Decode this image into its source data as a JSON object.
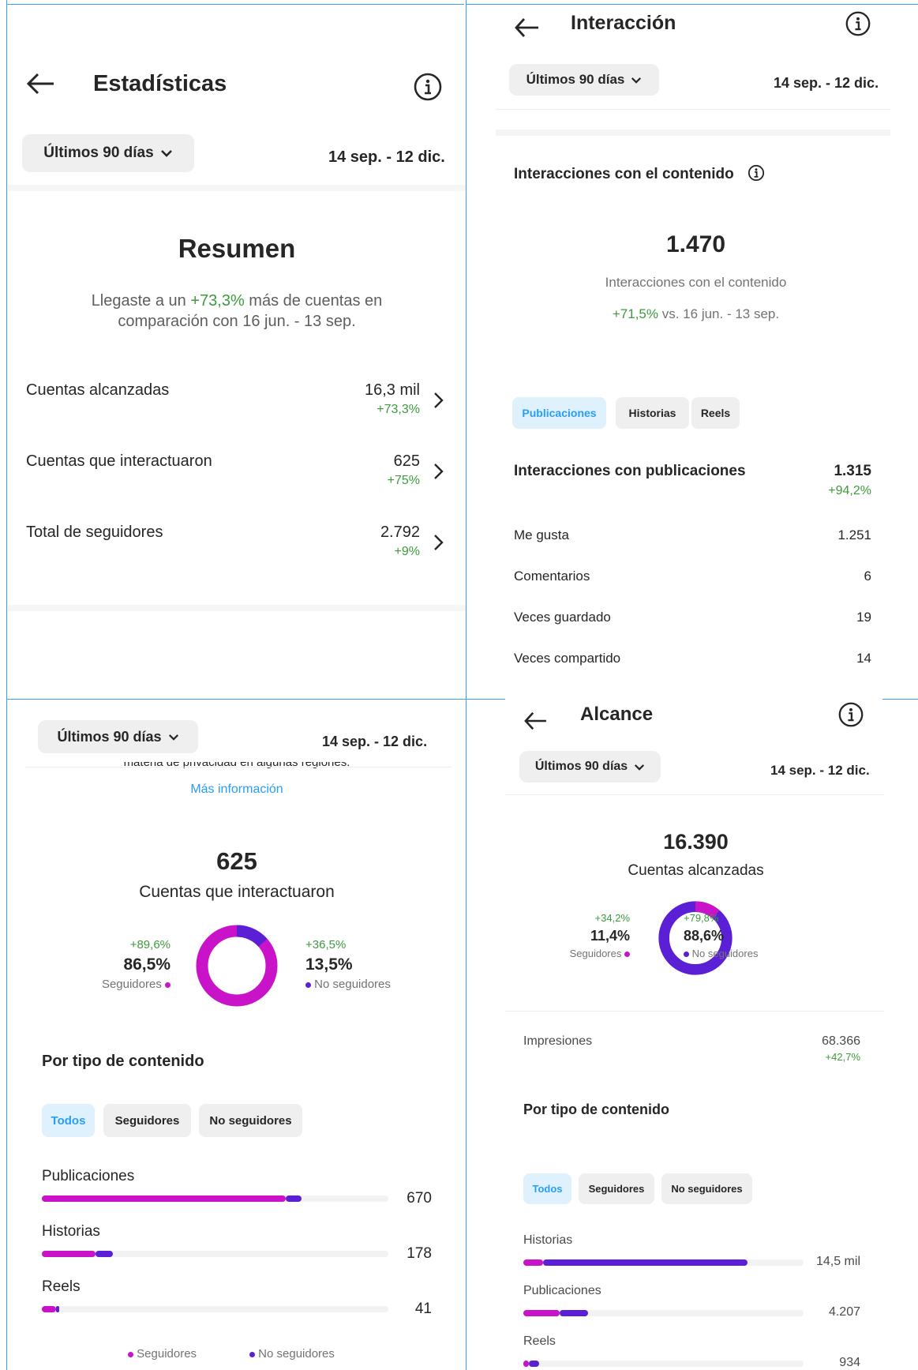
{
  "colors": {
    "magenta": "#c913c9",
    "purple": "#5b1fd6",
    "green": "#3d9a3d",
    "blue": "#2a9df4",
    "text": "#262626",
    "muted": "#737373"
  },
  "common": {
    "period_chip": "Últimos 90 días",
    "date_range": "14 sep. - 12 dic."
  },
  "p1": {
    "title": "Estadísticas",
    "summary_title": "Resumen",
    "summary_pre": "Llegaste a un ",
    "summary_pct": "+73,3%",
    "summary_post": " más de cuentas en",
    "summary_line2": "comparación con 16 jun. - 13 sep.",
    "rows": [
      {
        "label": "Cuentas alcanzadas",
        "value": "16,3 mil",
        "change": "+73,3%"
      },
      {
        "label": "Cuentas que interactuaron",
        "value": "625",
        "change": "+75%"
      },
      {
        "label": "Total de seguidores",
        "value": "2.792",
        "change": "+9%"
      }
    ]
  },
  "p2": {
    "title": "Interacción",
    "section_title": "Interacciones con el contenido",
    "big_number": "1.470",
    "big_label": "Interacciones con el contenido",
    "cmp_pct": "+71,5%",
    "cmp_rest": " vs. 16 jun. - 13 sep.",
    "tabs": [
      "Publicaciones",
      "Historias",
      "Reels"
    ],
    "pub_title": "Interacciones con publicaciones",
    "pub_value": "1.315",
    "pub_change": "+94,2%",
    "rows": [
      {
        "label": "Me gusta",
        "value": "1.251"
      },
      {
        "label": "Comentarios",
        "value": "6"
      },
      {
        "label": "Veces guardado",
        "value": "19"
      },
      {
        "label": "Veces compartido",
        "value": "14"
      }
    ]
  },
  "p3": {
    "cut_text": "materia de privacidad en algunas regiones.",
    "more_info": "Más información",
    "big_number": "625",
    "big_label": "Cuentas que interactuaron",
    "left_change": "+89,6%",
    "left_pct": "86,5%",
    "left_label": "Seguidores",
    "right_change": "+36,5%",
    "right_pct": "13,5%",
    "right_label": "No seguidores",
    "donut_followers_fraction": 0.865,
    "section_title": "Por tipo de contenido",
    "tabs": [
      "Todos",
      "Seguidores",
      "No seguidores"
    ],
    "bars": [
      {
        "label": "Publicaciones",
        "value": "670",
        "followers_fraction": 0.705,
        "non_followers_fraction": 0.045
      },
      {
        "label": "Historias",
        "value": "178",
        "followers_fraction": 0.155,
        "non_followers_fraction": 0.05
      },
      {
        "label": "Reels",
        "value": "41",
        "followers_fraction": 0.04,
        "non_followers_fraction": 0.01
      }
    ],
    "legend_followers": "Seguidores",
    "legend_non_followers": "No seguidores"
  },
  "p4": {
    "title": "Alcance",
    "big_number": "16.390",
    "big_label": "Cuentas alcanzadas",
    "left_change": "+34,2%",
    "left_pct": "11,4%",
    "left_label": "Seguidores",
    "right_change": "+79,8%",
    "right_pct": "88,6%",
    "right_label": "No seguidores",
    "donut_followers_fraction": 0.114,
    "impressions_label": "Impresiones",
    "impressions_value": "68.366",
    "impressions_change": "+42,7%",
    "section_title": "Por tipo de contenido",
    "tabs": [
      "Todos",
      "Seguidores",
      "No seguidores"
    ],
    "bars": [
      {
        "label": "Historias",
        "value": "14,5 mil",
        "followers_fraction": 0.07,
        "non_followers_fraction": 0.73
      },
      {
        "label": "Publicaciones",
        "value": "4.207",
        "followers_fraction": 0.13,
        "non_followers_fraction": 0.1
      },
      {
        "label": "Reels",
        "value": "934",
        "followers_fraction": 0.02,
        "non_followers_fraction": 0.035
      }
    ]
  }
}
